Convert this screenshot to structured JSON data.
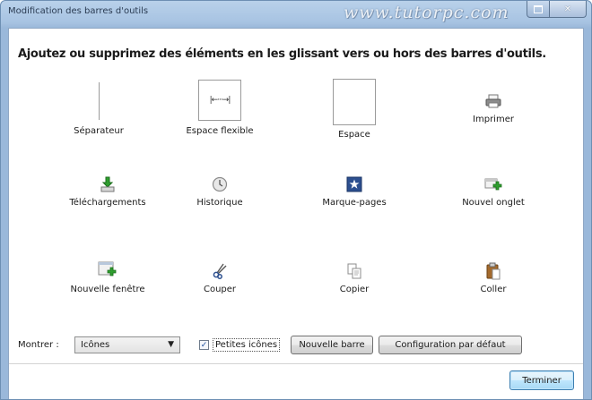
{
  "window": {
    "title": "Modification des barres d'outils",
    "watermark": "www.tutorpc.com"
  },
  "instructions": "Ajoutez ou supprimez des éléments en les glissant vers ou hors des barres d'outils.",
  "items": [
    {
      "label": "Séparateur",
      "icon": "separator-icon"
    },
    {
      "label": "Espace flexible",
      "icon": "flexible-space-icon",
      "glyph": "|←···→|"
    },
    {
      "label": "Espace",
      "icon": "space-icon"
    },
    {
      "label": "Imprimer",
      "icon": "printer-icon"
    },
    {
      "label": "Téléchargements",
      "icon": "download-icon"
    },
    {
      "label": "Historique",
      "icon": "history-clock-icon"
    },
    {
      "label": "Marque-pages",
      "icon": "bookmark-star-icon"
    },
    {
      "label": "Nouvel onglet",
      "icon": "new-tab-icon"
    },
    {
      "label": "Nouvelle fenêtre",
      "icon": "new-window-icon"
    },
    {
      "label": "Couper",
      "icon": "scissors-icon"
    },
    {
      "label": "Copier",
      "icon": "copy-icon"
    },
    {
      "label": "Coller",
      "icon": "paste-clipboard-icon"
    }
  ],
  "controls": {
    "show_label": "Montrer :",
    "show_value": "Icônes",
    "small_icons_label": "Petites icônes",
    "small_icons_checked": true,
    "new_bar_label": "Nouvelle barre",
    "default_config_label": "Configuration par défaut",
    "done_label": "Terminer"
  },
  "colors": {
    "accent_green": "#2f9e2f",
    "bookmark_blue": "#2c4f8f"
  }
}
